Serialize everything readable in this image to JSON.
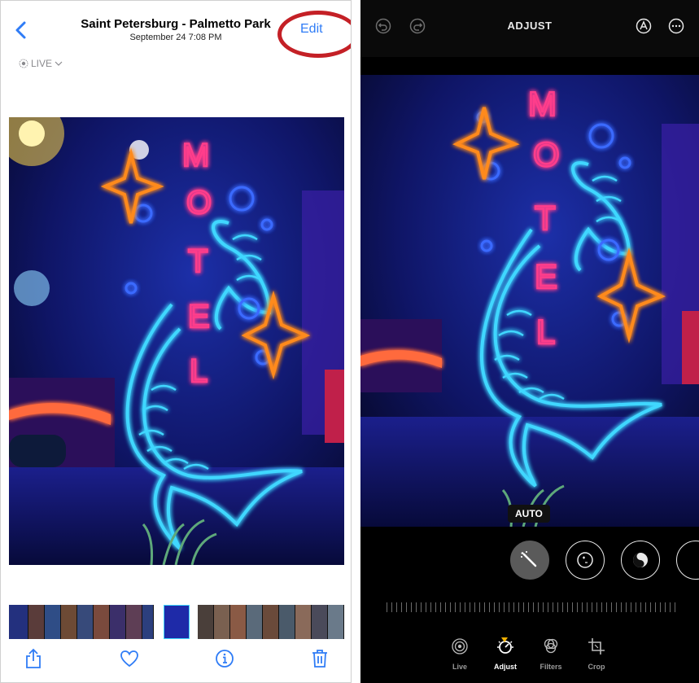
{
  "viewer": {
    "title": "Saint Petersburg - Palmetto Park",
    "subtitle": "September 24  7:08 PM",
    "edit_label": "Edit",
    "live_label": "LIVE",
    "sign_letters": [
      "M",
      "O",
      "T",
      "E",
      "L"
    ],
    "toolbar": {
      "share_icon": "share-icon",
      "favorite_icon": "heart-icon",
      "info_icon": "info-icon",
      "delete_icon": "trash-icon"
    }
  },
  "editor": {
    "title": "ADJUST",
    "auto_label": "AUTO",
    "tools": [
      "auto-enhance",
      "exposure",
      "brilliance"
    ],
    "tabs": [
      {
        "label": "Live"
      },
      {
        "label": "Adjust"
      },
      {
        "label": "Filters"
      },
      {
        "label": "Crop"
      }
    ],
    "active_tab": "Adjust"
  },
  "colors": {
    "accent_blue": "#2f7cf6",
    "highlight_ring": "#c42026",
    "neon_pink": "#ff3d8b",
    "neon_cyan": "#3fd7ff",
    "neon_orange": "#ff8a1e",
    "active_marker": "#f0b000"
  }
}
